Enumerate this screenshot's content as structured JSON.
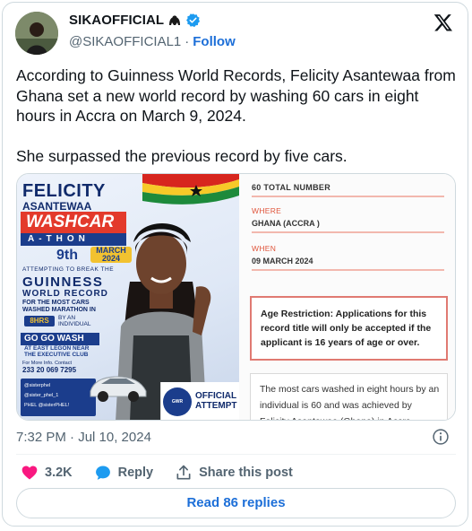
{
  "header": {
    "display_name": "SIKAOFFICIAL",
    "handle": "@SIKAOFFICIAL1",
    "separator": "·",
    "follow_label": "Follow",
    "name_emoji_icon": "gorilla-emoji-icon",
    "verified_icon": "verified-badge-icon",
    "verified_color": "#1d9bf0",
    "brand_icon": "x-logo-icon"
  },
  "tweet": {
    "paragraph_1": "According to Guinness World Records, Felicity Asantewaa from Ghana set a new world record by washing 60 cars in eight hours in Accra on March 9, 2024.",
    "paragraph_2": "She surpassed the previous record by five cars."
  },
  "media": {
    "poster": {
      "name_line_1": "FELICITY",
      "name_line_2": "ASANTEWAA",
      "washcar": "WASHCAR",
      "athon": "A-THON",
      "day": "9th",
      "date": "MARCH 2024",
      "attempting": "ATTEMPTING TO BREAK THE",
      "guinness": "GUINNESS",
      "world_record": "WORLD RECORD",
      "most_cars": "FOR THE MOST CARS WASHED MARATHON IN",
      "hours": "8HRS",
      "by_individual": "BY AN INDIVIDUAL",
      "venue_title": "GO GO WASH",
      "venue_detail": "AT EAST LEGON NEAR THE EXECUTIVE CLUB",
      "contact_label": "For More Info. Contact",
      "phone": "233 20 069 7295",
      "social_1": "@sisterphel",
      "social_2": "@sister_phel_1",
      "social_3": "PHEL @sisterPHEL!",
      "official": "OFFICIAL",
      "attempt": "ATTEMPT"
    },
    "record": {
      "total": "60 TOTAL NUMBER",
      "where_label": "WHERE",
      "where_value": "GHANA (ACCRA )",
      "when_label": "WHEN",
      "when_value": "09 MARCH 2024",
      "restriction": "Age Restriction: Applications for this record title will only be accepted if the applicant is 16 years of age or over.",
      "summary": "The most cars washed in eight hours by an individual is 60 and was achieved by Felicity Asantewaa (Ghana) in Accra"
    }
  },
  "footer": {
    "timestamp": "7:32 PM · Jul 10, 2024",
    "like_count": "3.2K",
    "reply_label": "Reply",
    "share_label": "Share this post",
    "read_replies": "Read 86 replies"
  },
  "colors": {
    "accent": "#1d6fd8",
    "like": "#f91880",
    "reply_bubble": "#1d9bf0",
    "muted": "#536471"
  }
}
